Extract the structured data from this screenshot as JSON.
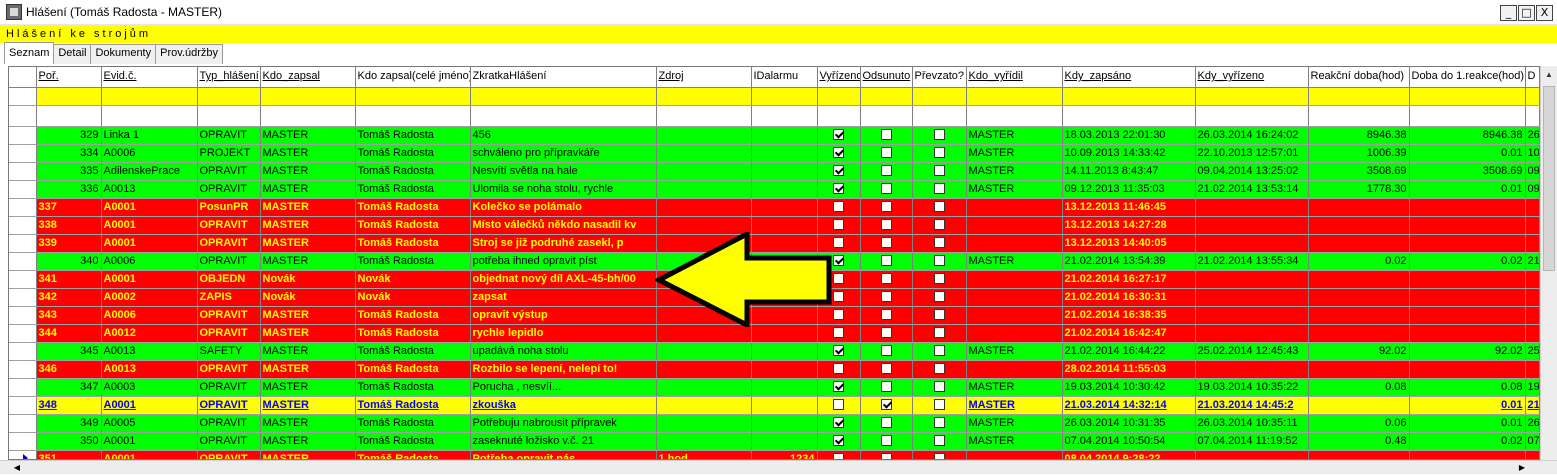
{
  "window": {
    "title": "Hlášení (Tomáš Radosta - MASTER)",
    "subtitle": "Hlášení ke strojům",
    "buttons": {
      "minimize": "_",
      "maximize": "□",
      "close": "X"
    }
  },
  "tabs": [
    {
      "label": "Seznam",
      "active": true
    },
    {
      "label": "Detail",
      "active": false
    },
    {
      "label": "Dokumenty",
      "active": false
    },
    {
      "label": "Prov.údržby",
      "active": false
    }
  ],
  "columns": [
    "Poř.",
    "Evid.č.",
    "Typ_hlášení",
    "Kdo_zapsal",
    "Kdo zapsal(celé jméno)",
    "ZkratkaHlášení",
    "Zdroj",
    "IDalarmu",
    "Vyřízeno",
    "Odsunuto",
    "Převzato?",
    "Kdo_vyřídil",
    "Kdy_zapsáno",
    "Kdy_vyřízeno",
    "Reakční doba(hod)",
    "Doba do 1.reakce(hod)",
    "D"
  ],
  "rows": [
    {
      "c": [
        "329",
        "Linka 1",
        "OPRAVIT",
        "MASTER",
        "Tomáš Radosta",
        "456",
        "",
        "",
        "",
        "",
        "",
        "MASTER",
        "18.03.2013 22:01:30",
        "26.03.2014 16:24:02",
        "8946.38",
        "8946.38",
        "26"
      ],
      "status": "green",
      "vyrizeno": true,
      "odsunuto": false,
      "prevzato": false
    },
    {
      "c": [
        "334",
        "A0006",
        "PROJEKT",
        "MASTER",
        "Tomáš Radosta",
        "schváleno pro přípravkáře",
        "",
        "",
        "",
        "",
        "",
        "MASTER",
        "10.09.2013 14:33:42",
        "22.10.2013 12:57:01",
        "1006.39",
        "0.01",
        "10"
      ],
      "status": "green",
      "vyrizeno": true,
      "odsunuto": false,
      "prevzato": false
    },
    {
      "c": [
        "335",
        "AdilenskePrace",
        "OPRAVIT",
        "MASTER",
        "Tomáš Radosta",
        "Nesvítí světla na hale",
        "",
        "",
        "",
        "",
        "",
        "MASTER",
        "14.11.2013 8:43:47",
        "09.04.2014 13:25:02",
        "3508.69",
        "3508.69",
        "09"
      ],
      "status": "green",
      "vyrizeno": true,
      "odsunuto": false,
      "prevzato": false
    },
    {
      "c": [
        "336",
        "A0013",
        "OPRAVIT",
        "MASTER",
        "Tomáš Radosta",
        "Ulomila se noha stolu, rychle",
        "",
        "",
        "",
        "",
        "",
        "MASTER",
        "09.12.2013 11:35:03",
        "21.02.2014 13:53:14",
        "1778.30",
        "0.01",
        "09"
      ],
      "status": "green",
      "vyrizeno": true,
      "odsunuto": false,
      "prevzato": false
    },
    {
      "c": [
        "337",
        "A0001",
        "PosunPR",
        "MASTER",
        "Tomáš Radosta",
        "Kolečko se polámalo",
        "",
        "",
        "",
        "",
        "",
        "",
        "13.12.2013 11:46:45",
        "",
        "",
        "",
        ""
      ],
      "status": "red",
      "vyrizeno": false,
      "odsunuto": false,
      "prevzato": false
    },
    {
      "c": [
        "338",
        "A0001",
        "OPRAVIT",
        "MASTER",
        "Tomáš Radosta",
        "Místo válečků někdo nasadil kv",
        "",
        "",
        "",
        "",
        "",
        "",
        "13.12.2013 14:27:28",
        "",
        "",
        "",
        ""
      ],
      "status": "red",
      "vyrizeno": false,
      "odsunuto": false,
      "prevzato": false
    },
    {
      "c": [
        "339",
        "A0001",
        "OPRAVIT",
        "MASTER",
        "Tomáš Radosta",
        "Stroj se již podruhé zasekl, p",
        "",
        "",
        "",
        "",
        "",
        "",
        "13.12.2013 14:40:05",
        "",
        "",
        "",
        ""
      ],
      "status": "red",
      "vyrizeno": false,
      "odsunuto": false,
      "prevzato": false
    },
    {
      "c": [
        "340",
        "A0006",
        "OPRAVIT",
        "MASTER",
        "Tomáš Radosta",
        "potřeba ihned opravit píst",
        "",
        "",
        "",
        "",
        "",
        "MASTER",
        "21.02.2014 13:54:39",
        "21.02.2014 13:55:34",
        "0.02",
        "0.02",
        "21"
      ],
      "status": "green",
      "vyrizeno": true,
      "odsunuto": false,
      "prevzato": false
    },
    {
      "c": [
        "341",
        "A0001",
        "OBJEDN",
        "Novák",
        "Novák",
        "objednat nový díl AXL-45-bh/00",
        "",
        "",
        "",
        "",
        "",
        "",
        "21.02.2014 16:27:17",
        "",
        "",
        "",
        ""
      ],
      "status": "red",
      "vyrizeno": false,
      "odsunuto": false,
      "prevzato": false
    },
    {
      "c": [
        "342",
        "A0002",
        "ZAPIS",
        "Novák",
        "Novák",
        "zapsat",
        "",
        "",
        "",
        "",
        "",
        "",
        "21.02.2014 16:30:31",
        "",
        "",
        "",
        ""
      ],
      "status": "red",
      "vyrizeno": false,
      "odsunuto": false,
      "prevzato": false
    },
    {
      "c": [
        "343",
        "A0006",
        "OPRAVIT",
        "MASTER",
        "Tomáš Radosta",
        "opravit výstup",
        "",
        "",
        "",
        "",
        "",
        "",
        "21.02.2014 16:38:35",
        "",
        "",
        "",
        ""
      ],
      "status": "red",
      "vyrizeno": false,
      "odsunuto": false,
      "prevzato": false
    },
    {
      "c": [
        "344",
        "A0012",
        "OPRAVIT",
        "MASTER",
        "Tomáš Radosta",
        "rychle lepidlo",
        "",
        "",
        "",
        "",
        "",
        "",
        "21.02.2014 16:42:47",
        "",
        "",
        "",
        ""
      ],
      "status": "red",
      "vyrizeno": false,
      "odsunuto": false,
      "prevzato": false
    },
    {
      "c": [
        "345",
        "A0013",
        "SAFETY",
        "MASTER",
        "Tomáš Radosta",
        "upadává noha stolu",
        "",
        "",
        "",
        "",
        "",
        "MASTER",
        "21.02.2014 16:44:22",
        "25.02.2014 12:45:43",
        "92.02",
        "92.02",
        "25"
      ],
      "status": "green",
      "vyrizeno": true,
      "odsunuto": false,
      "prevzato": false
    },
    {
      "c": [
        "346",
        "A0013",
        "OPRAVIT",
        "MASTER",
        "Tomáš Radosta",
        "Rozbilo se lepení, nelepí to!",
        "",
        "",
        "",
        "",
        "",
        "",
        "28.02.2014 11:55:03",
        "",
        "",
        "",
        ""
      ],
      "status": "red",
      "vyrizeno": false,
      "odsunuto": false,
      "prevzato": false
    },
    {
      "c": [
        "347",
        "A0003",
        "OPRAVIT",
        "MASTER",
        "Tomáš Radosta",
        "Porucha , nesvíí...",
        "",
        "",
        "",
        "",
        "",
        "MASTER",
        "19.03.2014 10:30:42",
        "19.03.2014 10:35:22",
        "0.08",
        "0.08",
        "19"
      ],
      "status": "green",
      "vyrizeno": true,
      "odsunuto": false,
      "prevzato": false
    },
    {
      "c": [
        "348",
        "A0001",
        "OPRAVIT",
        "MASTER",
        "Tomáš Radosta",
        "zkouška",
        "",
        "",
        "",
        "",
        "",
        "MASTER",
        "21.03.2014 14:32:14",
        "21.03.2014 14:45:2",
        "",
        "0.01",
        "21"
      ],
      "status": "yellow",
      "vyrizeno": false,
      "odsunuto": true,
      "prevzato": false
    },
    {
      "c": [
        "349",
        "A0005",
        "OPRAVIT",
        "MASTER",
        "Tomáš Radosta",
        "Potřebuju nabrousit přípravek",
        "",
        "",
        "",
        "",
        "",
        "MASTER",
        "26.03.2014 10:31:35",
        "26.03.2014 10:35:11",
        "0.06",
        "0.01",
        "26"
      ],
      "status": "green",
      "vyrizeno": true,
      "odsunuto": false,
      "prevzato": false
    },
    {
      "c": [
        "350",
        "A0001",
        "OPRAVIT",
        "MASTER",
        "Tomáš Radosta",
        "zaseknuté ložisko v.č. 21",
        "",
        "",
        "",
        "",
        "",
        "MASTER",
        "07.04.2014 10:50:54",
        "07.04.2014 11:19:52",
        "0.48",
        "0.02",
        "07"
      ],
      "status": "green",
      "vyrizeno": true,
      "odsunuto": false,
      "prevzato": false
    },
    {
      "c": [
        "351",
        "A0001",
        "OPRAVIT",
        "MASTER",
        "Tomáš Radosta",
        "Potřeba opravit pás",
        "1 hod",
        "1234",
        "",
        "",
        "",
        "",
        "08.04.2014 9:28:22",
        "",
        "",
        "",
        ""
      ],
      "status": "red",
      "vyrizeno": false,
      "odsunuto": false,
      "prevzato": false,
      "current": true
    }
  ],
  "colors": {
    "green": "#00ff00",
    "red": "#ff0000",
    "yellow": "#ffff00",
    "arrow_fill": "#ffff00"
  },
  "icons": {
    "app": "app-icon",
    "overlay": "left-arrow-icon",
    "row_pointer": "row-pointer-icon"
  }
}
